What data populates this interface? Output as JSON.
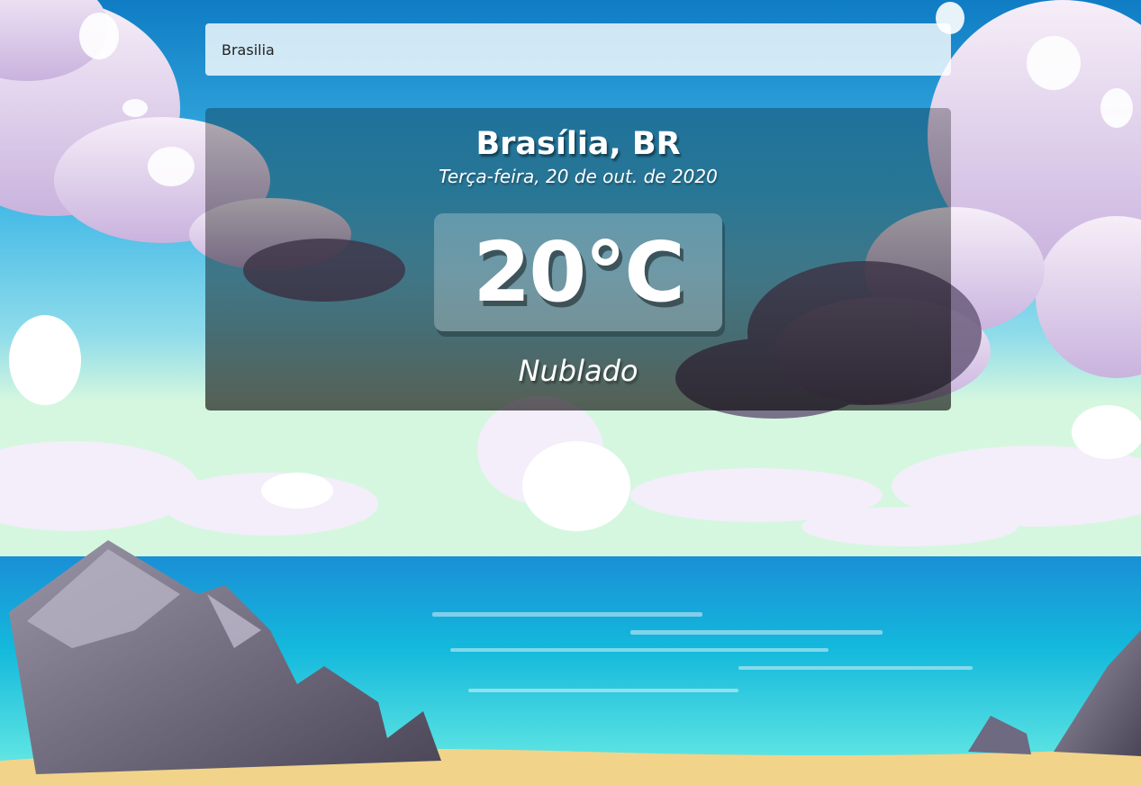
{
  "search": {
    "value": "Brasilia"
  },
  "weather": {
    "location": "Brasília, BR",
    "date": "Terça-feira, 20 de out. de 2020",
    "temperature": "20°C",
    "condition": "Nublado"
  },
  "colors": {
    "sky_top": "#1b8fd1",
    "sky_bottom": "#bff0e6",
    "sea": "#1fb8d8",
    "sand": "#f2d38a",
    "cloud": "#e7d8ee",
    "rock": "#6d6a82"
  }
}
